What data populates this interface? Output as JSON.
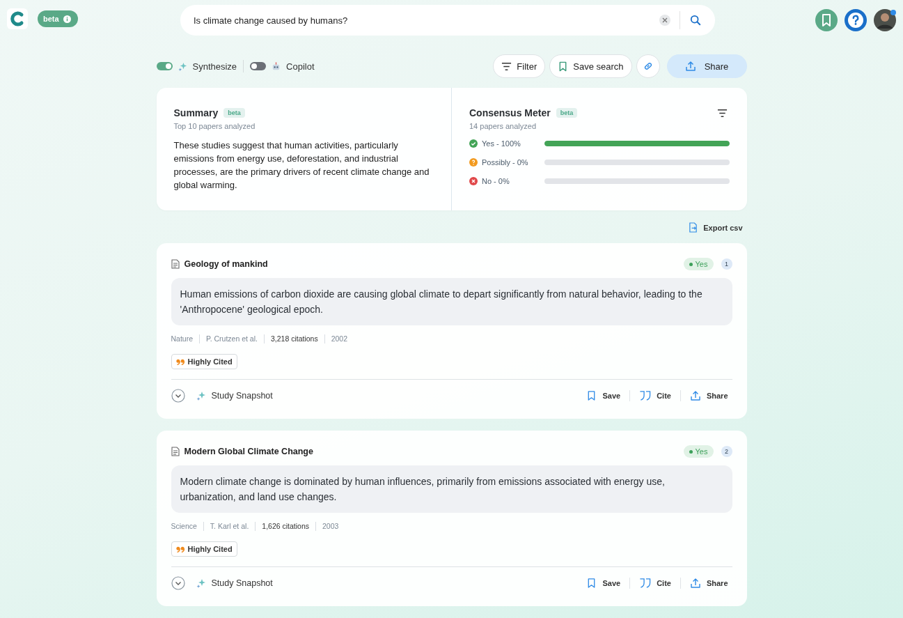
{
  "header": {
    "beta_label": "beta",
    "search": {
      "value": "Is climate change caused by humans?"
    }
  },
  "toolbar": {
    "toggles": [
      {
        "label": "Synthesize",
        "on": true,
        "kind": "sparkle"
      },
      {
        "label": "Copilot",
        "on": false,
        "kind": "robot"
      }
    ],
    "buttons": [
      {
        "label": "Filter",
        "kind": "filter"
      },
      {
        "label": "Save search",
        "kind": "bookmark"
      },
      {
        "kind": "link"
      },
      {
        "label": "Share",
        "kind": "share"
      }
    ]
  },
  "summary": {
    "title": "Summary",
    "badge": "beta",
    "subtitle": "Top 10 papers analyzed",
    "text": "These studies suggest that human activities, particularly emissions from energy use, deforestation, and industrial processes, are the primary drivers of recent climate change and global warming."
  },
  "consensus": {
    "title": "Consensus Meter",
    "badge": "beta",
    "subtitle": "14 papers analyzed",
    "rows": [
      {
        "kind": "yes",
        "label": "Yes - 100%",
        "level": 1
      },
      {
        "kind": "possibly",
        "label": "Possibly - 0%",
        "level": 0
      },
      {
        "kind": "no",
        "label": "No - 0%",
        "level": 0
      }
    ]
  },
  "export": {
    "label": "Export csv"
  },
  "papers": [
    {
      "title": "Geology of mankind",
      "verdict": "Yes",
      "index": "1",
      "claim": "Human emissions of carbon dioxide are causing global climate to depart significantly from natural behavior, leading to the 'Anthropocene' geological epoch.",
      "journal": "Nature",
      "authors": "P. Crutzen et al.",
      "citations": "3,218 citations",
      "year": "2002",
      "badge": "Highly Cited",
      "snapshot": "Study Snapshot",
      "actions": [
        "Save",
        "Cite",
        "Share"
      ]
    },
    {
      "title": "Modern Global Climate Change",
      "verdict": "Yes",
      "index": "2",
      "claim": "Modern climate change is dominated by human influences, primarily from emissions associated with energy use, urbanization, and land use changes.",
      "journal": "Science",
      "authors": "T. Karl et al.",
      "citations": "1,626 citations",
      "year": "2003",
      "badge": "Highly Cited",
      "snapshot": "Study Snapshot",
      "actions": [
        "Save",
        "Cite",
        "Share"
      ]
    }
  ]
}
